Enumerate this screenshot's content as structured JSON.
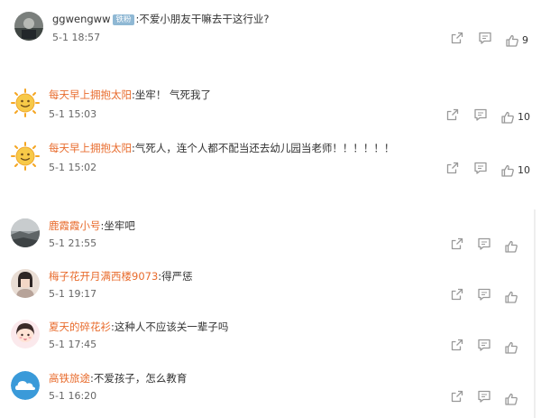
{
  "comments": [
    {
      "user": "ggwengww",
      "badge": "铁粉",
      "text": ":不爱小朋友干嘛去干这行业?",
      "time": "5-1 18:57",
      "likes": "9",
      "avatar": "gray-photo-avatar"
    },
    {
      "user": "每天早上拥抱太阳",
      "text": ":坐牢！ 气死我了",
      "time": "5-1 15:03",
      "likes": "10",
      "avatar": "sun-face-avatar"
    },
    {
      "user": "每天早上拥抱太阳",
      "text": ":气死人，连个人都不配当还去幼儿园当老师！！！！！！",
      "time": "5-1 15:02",
      "likes": "10",
      "avatar": "sun-face-avatar"
    },
    {
      "user": "鹿霞霞小号",
      "text": ":坐牢吧",
      "time": "5-1 21:55",
      "likes": "",
      "avatar": "landscape-photo-avatar"
    },
    {
      "user": "梅子花开月满西楼9073",
      "text": ":得严惩",
      "time": "5-1 19:17",
      "likes": "",
      "avatar": "girl-photo-avatar"
    },
    {
      "user": "夏天的碎花衫",
      "text": ":这种人不应该关一辈子吗",
      "time": "5-1 17:45",
      "likes": "",
      "avatar": "cartoon-girl-avatar"
    },
    {
      "user": "高铁旅途",
      "text": ":不爱孩子，怎么教育",
      "time": "5-1 16:20",
      "likes": "",
      "avatar": "blue-cloud-avatar"
    }
  ],
  "colors": {
    "username": "#e86b2c",
    "text": "#333333",
    "time": "#666666",
    "icon": "#999999",
    "badge": "#8fb8d4"
  },
  "icons": {
    "forward": "forward-icon",
    "comment": "comment-icon",
    "like": "like-icon"
  }
}
